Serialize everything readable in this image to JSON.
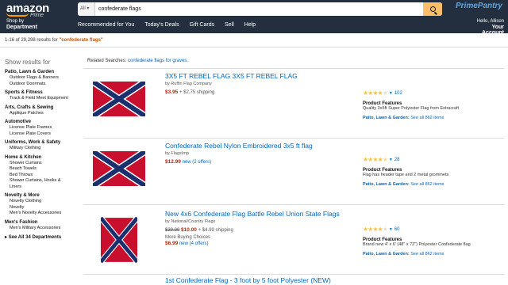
{
  "header": {
    "logo_text": "amazon",
    "logo_sub": "Prime",
    "search_category": "All",
    "search_value": "confederate flags",
    "prime_pantry": "PrimePantry",
    "shop_by_top": "Shop by",
    "shop_by_bottom": "Department",
    "nav_links": [
      "Recommended for You",
      "Today's Deals",
      "Gift Cards",
      "Sell",
      "Help"
    ],
    "account_greeting": "Hello, Allison",
    "account_label": "Your Account"
  },
  "results": {
    "count_text": "1-16 of 29,298 results for ",
    "query_text": "\"confederate flags\""
  },
  "sidebar": {
    "title": "Show results for",
    "categories": [
      {
        "label": "Patio, Lawn & Garden",
        "subs": [
          "Outdoor Flags & Banners",
          "Outdoor Doormats"
        ]
      },
      {
        "label": "Sports & Fitness",
        "subs": [
          "Track & Field Meet Equipment"
        ]
      },
      {
        "label": "Arts, Crafts & Sewing",
        "subs": [
          "Applique Patches"
        ]
      },
      {
        "label": "Automotive",
        "subs": [
          "License Plate Frames",
          "License Plate Covers"
        ]
      },
      {
        "label": "Uniforms, Work & Safety",
        "subs": [
          "Military Clothing"
        ]
      },
      {
        "label": "Home & Kitchen",
        "subs": [
          "Shower Curtains",
          "Beach Towels",
          "Bed Throws",
          "Shower Curtains, Hooks &",
          "Liners"
        ]
      },
      {
        "label": "Novelty & More",
        "subs": [
          "Novelty Clothing",
          "Novelty",
          "Men's Novelty Accessories"
        ]
      },
      {
        "label": "Men's Fashion",
        "subs": [
          "Men's Military Accessories"
        ]
      }
    ],
    "see_all": "See All 34 Departments"
  },
  "related": {
    "label": "Related Searches: ",
    "link": "confederate flags for graves."
  },
  "items": [
    {
      "title": "3X5 FT REBEL FLAG 3X5 FT REBEL FLAG",
      "by": "by Ruffin Flag Company",
      "price": "$3.95",
      "extra": "+ $2.75 shipping",
      "rating_count": "102",
      "stars": 4,
      "pf_title": "Product Features",
      "pf_text": "Quality 3x5ft Super Polyester Flag from Extracraft",
      "category": "Patio, Lawn & Garden:",
      "see_all": "See all 862 items"
    },
    {
      "title": "Confederate Rebel Nylon Embroidered 3x5 ft flag",
      "by": "by FlagsImp",
      "price": "$12.99",
      "extra": "new (2 offers)",
      "rating_count": "28",
      "stars": 4.5,
      "pf_title": "Product Features",
      "pf_text": "Flag has header tape and 2 metal grommets",
      "category": "Patio, Lawn & Garden:",
      "see_all": "See all 862 items"
    },
    {
      "title": "New 4x6 Confederate Flag Battle Rebel Union State Flags",
      "by": "by National/Country Flags",
      "old_price": "$39.99",
      "price": "$10.00",
      "extra": "+ $4.99 shipping",
      "more_choices": "More Buying Choices",
      "price2": "$6.99",
      "extra2": "new (4 offers)",
      "rating_count": "60",
      "stars": 4,
      "pf_title": "Product Features",
      "pf_text": "Brand new 4' x 6' (48\" x 72\") Polyester Confederate flag",
      "category": "Patio, Lawn & Garden:",
      "see_all": "See all 862 items"
    },
    {
      "title": "1st Confederate Flag - 3 foot by 5 foot Polyester (NEW)"
    }
  ],
  "colors": {
    "header_bg": "#232f3e",
    "link": "#0066c0",
    "price": "#b12704",
    "search_btn": "#febd69",
    "star": "#f0c14b"
  }
}
